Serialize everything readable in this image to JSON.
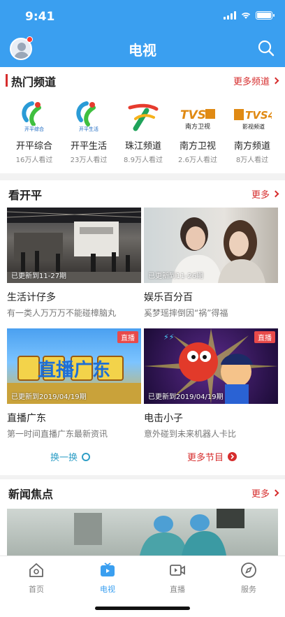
{
  "status": {
    "time": "9:41"
  },
  "header": {
    "title": "电视"
  },
  "hot": {
    "title": "热门频道",
    "more": "更多频道",
    "channels": [
      {
        "name": "开平综合",
        "views": "16万人看过",
        "logo_text": "开平综合"
      },
      {
        "name": "开平生活",
        "views": "23万人看过",
        "logo_text": "开平生活"
      },
      {
        "name": "珠江频道",
        "views": "8.9万人看过",
        "logo_text": ""
      },
      {
        "name": "南方卫视",
        "views": "2.6万人看过",
        "logo_text": "南方卫视"
      },
      {
        "name": "南方频道",
        "views": "8万人看过",
        "logo_text": "影视频道"
      }
    ]
  },
  "kaiping": {
    "title": "看开平",
    "more": "更多",
    "tiles": [
      {
        "title": "生活计仔多",
        "desc": "有一类人万万万不能碰樟脑丸",
        "updated": "已更新到11-27期",
        "live": ""
      },
      {
        "title": "娱乐百分百",
        "desc": "奚梦瑶摔倒因“祸”得福",
        "updated": "已更新到11-26期",
        "live": ""
      },
      {
        "title": "直播广东",
        "desc": "第一时间直播广东最新资讯",
        "updated": "已更新到2019/04/19期",
        "live": "直播"
      },
      {
        "title": "电击小子",
        "desc": "意外碰到未来机器人卡比",
        "updated": "已更新到2019/04/19期",
        "live": "直播"
      }
    ],
    "swap": "换一换",
    "more_programs": "更多节目"
  },
  "news": {
    "title": "新闻焦点",
    "more": "更多"
  },
  "tabs": [
    {
      "label": "首页",
      "icon": "home-icon"
    },
    {
      "label": "电视",
      "icon": "tv-icon",
      "active": true
    },
    {
      "label": "直播",
      "icon": "live-camera-icon"
    },
    {
      "label": "服务",
      "icon": "compass-icon"
    }
  ],
  "colors": {
    "brand": "#3a9ff0",
    "accent": "#d62d2d",
    "swap": "#2e9ec6"
  }
}
